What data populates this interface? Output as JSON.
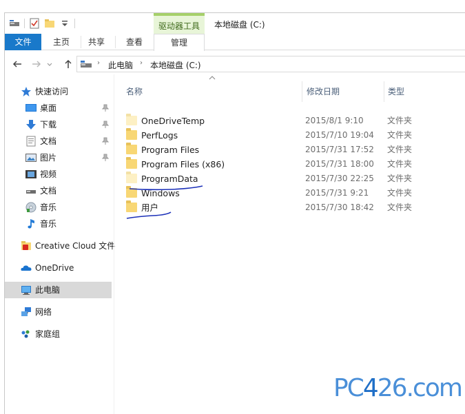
{
  "titlebar": {
    "context_tools_label": "驱动器工具",
    "window_title": "本地磁盘 (C:)"
  },
  "ribbon": {
    "tabs": [
      {
        "id": "file",
        "label": "文件"
      },
      {
        "id": "home",
        "label": "主页"
      },
      {
        "id": "share",
        "label": "共享"
      },
      {
        "id": "view",
        "label": "查看"
      },
      {
        "id": "manage",
        "label": "管理"
      }
    ]
  },
  "address": {
    "crumbs": [
      "此电脑",
      "本地磁盘 (C:)"
    ]
  },
  "navpane": {
    "items": [
      {
        "label": "快速访问",
        "icon": "star-icon"
      },
      {
        "label": "桌面",
        "icon": "desktop-icon",
        "pinned": true
      },
      {
        "label": "下载",
        "icon": "download-icon",
        "pinned": true
      },
      {
        "label": "文档",
        "icon": "document-icon",
        "pinned": true
      },
      {
        "label": "图片",
        "icon": "pictures-icon",
        "pinned": true
      },
      {
        "label": "视频",
        "icon": "video-icon"
      },
      {
        "label": "文档",
        "icon": "drive-icon"
      },
      {
        "label": "音乐",
        "icon": "cd-music-icon"
      },
      {
        "label": "音乐",
        "icon": "music-note-icon"
      },
      {
        "label": "Creative Cloud 文件",
        "icon": "creative-cloud-icon"
      },
      {
        "label": "OneDrive",
        "icon": "onedrive-icon"
      },
      {
        "label": "此电脑",
        "icon": "computer-icon",
        "selected": true
      },
      {
        "label": "网络",
        "icon": "network-icon"
      },
      {
        "label": "家庭组",
        "icon": "homegroup-icon"
      }
    ]
  },
  "columns": {
    "name": "名称",
    "date": "修改日期",
    "type": "类型"
  },
  "files": [
    {
      "name": "OneDriveTemp",
      "date": "2015/8/1 9:10",
      "type": "文件夹"
    },
    {
      "name": "PerfLogs",
      "date": "2015/7/10 19:04",
      "type": "文件夹"
    },
    {
      "name": "Program Files",
      "date": "2015/7/31 17:52",
      "type": "文件夹"
    },
    {
      "name": "Program Files (x86)",
      "date": "2015/7/31 18:00",
      "type": "文件夹"
    },
    {
      "name": "ProgramData",
      "date": "2015/7/30 22:25",
      "type": "文件夹"
    },
    {
      "name": "Windows",
      "date": "2015/7/31 9:21",
      "type": "文件夹"
    },
    {
      "name": "用户",
      "date": "2015/7/30 18:42",
      "type": "文件夹"
    }
  ],
  "watermark": {
    "part1": "PC",
    "part2": "4",
    "part3": "26",
    "part4": ".com"
  },
  "colors": {
    "file_tab": "#1979ca",
    "context_tools": "#e8f5d8",
    "selected_nav": "#d9d9d9",
    "annotation_pen": "#1a2fb8"
  }
}
